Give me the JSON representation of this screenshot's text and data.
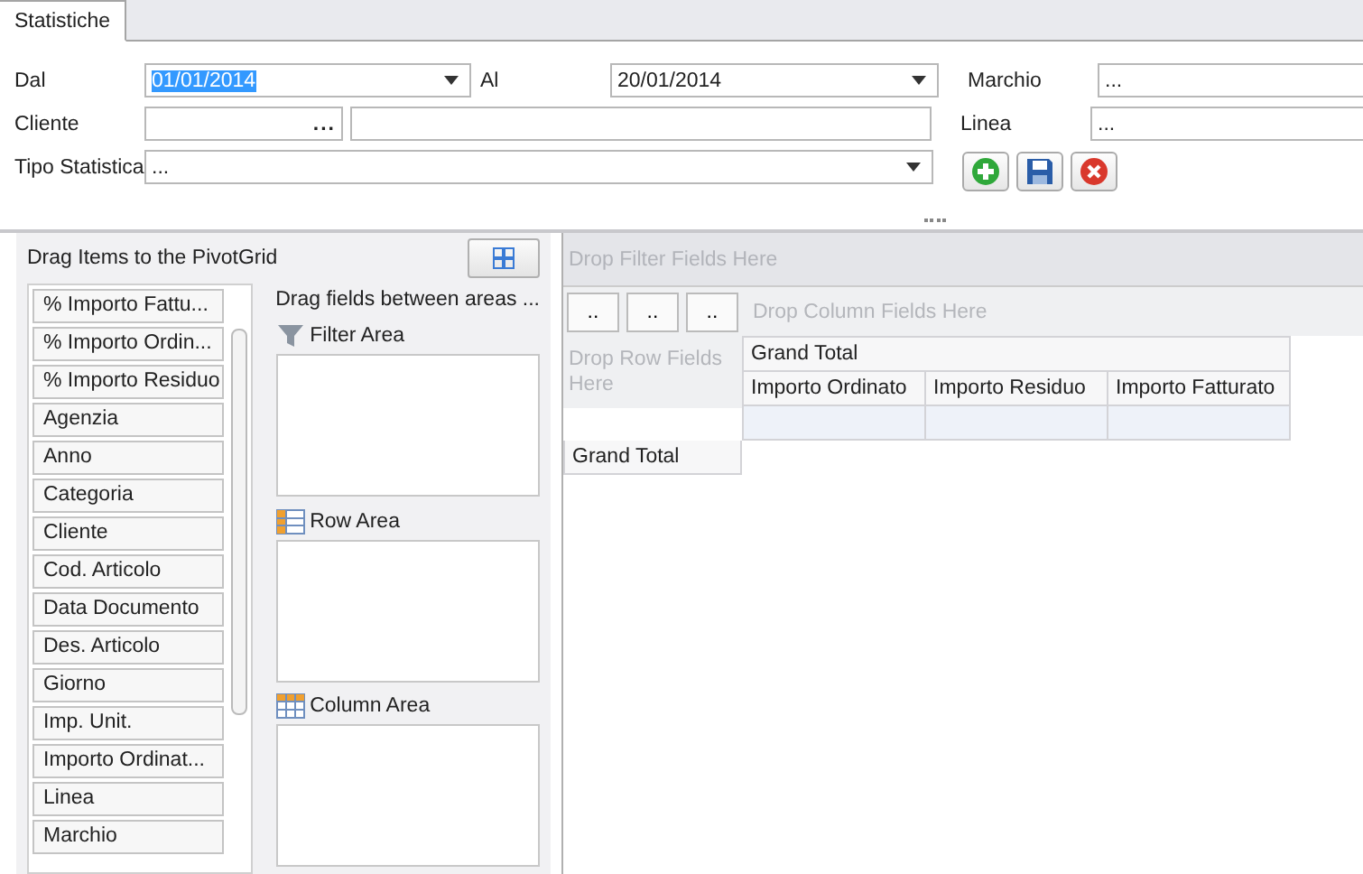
{
  "tabs": [
    {
      "label": "Statistiche",
      "selected": true
    }
  ],
  "form": {
    "dal": {
      "label": "Dal",
      "value": "01/01/2014"
    },
    "al": {
      "label": "Al",
      "value": "20/01/2014"
    },
    "marchio": {
      "label": "Marchio",
      "value": "..."
    },
    "cliente": {
      "label": "Cliente",
      "lookup": "..."
    },
    "linea": {
      "label": "Linea",
      "value": "..."
    },
    "tipo": {
      "label": "Tipo Statistica",
      "value": "..."
    }
  },
  "customization": {
    "title": "Drag Items to the PivotGrid",
    "hint": "Drag fields between areas ...",
    "fields": [
      "% Importo Fattu...",
      "% Importo Ordin...",
      "% Importo Residuo",
      "Agenzia",
      "Anno",
      "Categoria",
      "Cliente",
      "Cod. Articolo",
      "Data Documento",
      "Des. Articolo",
      "Giorno",
      "Imp. Unit.",
      "Importo Ordinat...",
      "Linea",
      "Marchio"
    ],
    "areas": [
      {
        "kind": "filter",
        "label": "Filter Area"
      },
      {
        "kind": "row",
        "label": "Row Area"
      },
      {
        "kind": "column",
        "label": "Column Area"
      }
    ]
  },
  "pivot": {
    "filter_placeholder": "Drop Filter Fields Here",
    "data_buttons": [
      "..",
      "..",
      ".."
    ],
    "column_placeholder": "Drop Column Fields Here",
    "row_placeholder": "Drop Row Fields Here",
    "grand_total_header": "Grand Total",
    "columns": [
      "Importo Ordinato",
      "Importo Residuo",
      "Importo Fatturato"
    ],
    "row_total": "Grand Total"
  }
}
